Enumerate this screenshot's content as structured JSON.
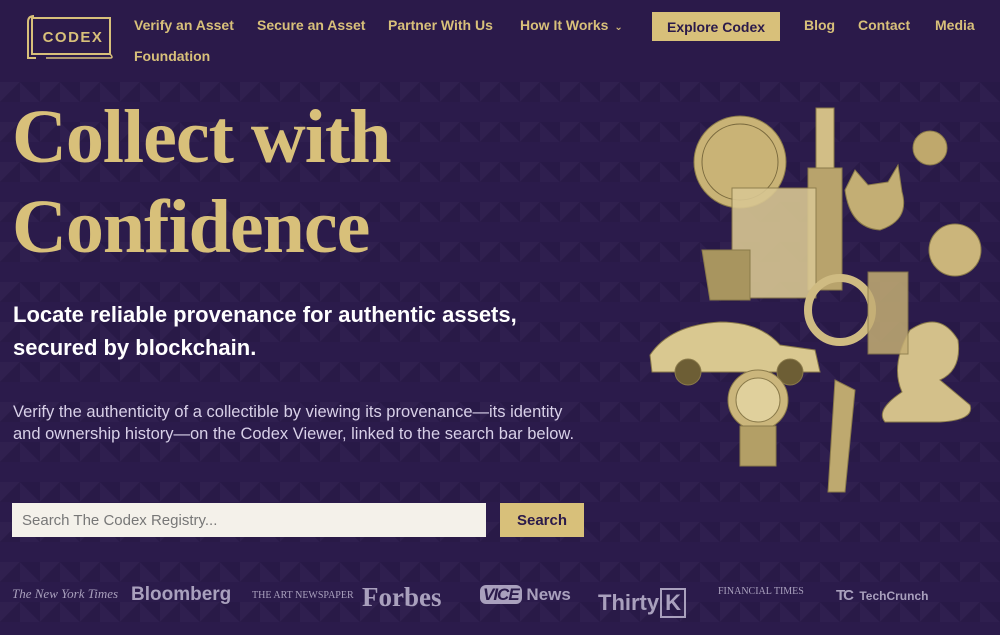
{
  "nav": {
    "logo_text": "CODEX",
    "links": {
      "verify": "Verify an Asset",
      "secure": "Secure an Asset",
      "partner": "Partner With Us",
      "how": "How It Works",
      "foundation": "Foundation",
      "blog": "Blog",
      "contact": "Contact",
      "media": "Media"
    },
    "cta": "Explore Codex"
  },
  "hero": {
    "headline_line1": "Collect with",
    "headline_line2": "Confidence",
    "subhead": "Locate reliable provenance for authentic assets, secured by blockchain.",
    "description": "Verify the authenticity of a collectible by viewing its provenance—its identity and ownership history—on the Codex Viewer, linked to the search bar below."
  },
  "search": {
    "placeholder": "Search The Codex Registry...",
    "button_label": "Search"
  },
  "press": {
    "nyt": "The New York Times",
    "bloomberg": "Bloomberg",
    "art_newspaper": "THE ART NEWSPAPER",
    "forbes": "Forbes",
    "vice_brand": "VICE",
    "vice_news": "News",
    "thirty_1": "Thirty",
    "thirty_2": "K",
    "ft": "FINANCIAL TIMES",
    "tc_mark": "TC",
    "tc": "TechCrunch"
  },
  "colors": {
    "background": "#2a1a47",
    "gold": "#d8c07a",
    "white": "#ffffff"
  }
}
